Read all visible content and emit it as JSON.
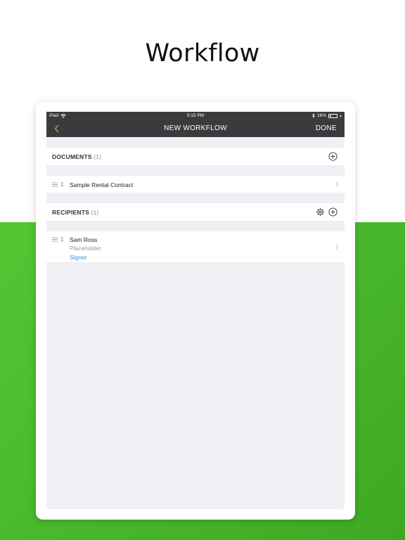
{
  "headline": "Workflow",
  "status_bar": {
    "device": "iPad",
    "time": "5:15 PM",
    "battery": "16%"
  },
  "nav": {
    "title": "NEW WORKFLOW",
    "done_label": "DONE"
  },
  "documents": {
    "label": "DOCUMENTS",
    "count": "(1)",
    "items": [
      {
        "index": "1",
        "name": "Sample Rental Contract"
      }
    ]
  },
  "recipients": {
    "label": "RECIPIENTS",
    "count": "(1)",
    "items": [
      {
        "index": "1",
        "name": "Sam Ross",
        "type": "Placeholder",
        "role": "Signer"
      }
    ]
  },
  "colors": {
    "accent_green": "#55c533",
    "nav_bg": "#3b3b3d",
    "link_blue": "#2f8fd8"
  }
}
